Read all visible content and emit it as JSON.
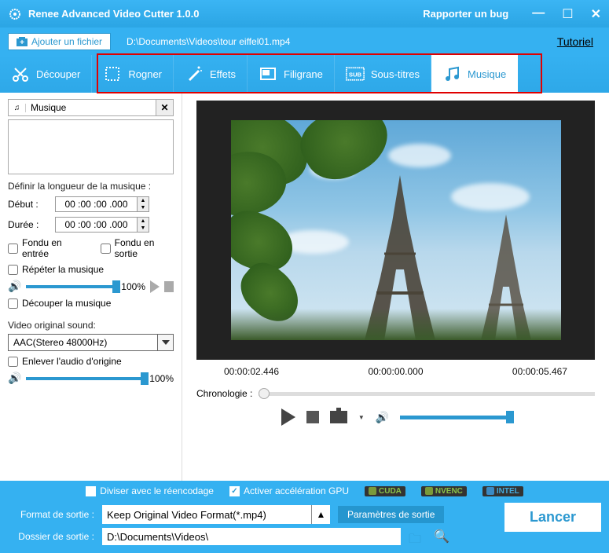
{
  "title": "Renee Advanced Video Cutter 1.0.0",
  "report_bug": "Rapporter un bug",
  "filebar": {
    "add_file": "Ajouter un fichier",
    "filepath": "D:\\Documents\\Videos\\tour eiffel01.mp4",
    "tutorial": "Tutoriel"
  },
  "toolbar": {
    "cut": "Découper",
    "crop": "Rogner",
    "effects": "Effets",
    "watermark": "Filigrane",
    "subtitles": "Sous-titres",
    "music": "Musique"
  },
  "left": {
    "music_field": "Musique",
    "define_length": "Définir la longueur de la musique :",
    "start": "Début :",
    "start_val": "00 :00 :00 .000",
    "duration": "Durée :",
    "duration_val": "00 :00 :00 .000",
    "fade_in": "Fondu en entrée",
    "fade_out": "Fondu en sortie",
    "repeat": "Répéter la musique",
    "volume_100": "100%",
    "cut_music": "Découper la musique",
    "original_sound": "Video original sound:",
    "audio_format": "AAC(Stereo 48000Hz)",
    "remove_audio": "Enlever l'audio d'origine"
  },
  "preview": {
    "t1": "00:00:02.446",
    "t2": "00:00:00.000",
    "t3": "00:00:05.467",
    "chronology": "Chronologie :"
  },
  "bottom": {
    "divide": "Diviser avec le réencodage",
    "gpu": "Activer accélération GPU",
    "cuda": "CUDA",
    "nvenc": "NVENC",
    "intel": "INTEL",
    "format_label": "Format de sortie :",
    "format_value": "Keep Original Video Format(*.mp4)",
    "params": "Paramètres de sortie",
    "folder_label": "Dossier de sortie :",
    "folder_value": "D:\\Documents\\Videos\\",
    "launch": "Lancer"
  }
}
